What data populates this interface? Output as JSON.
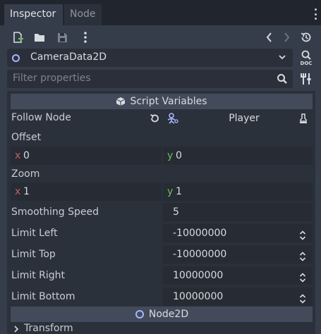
{
  "tabs": [
    {
      "label": "Inspector",
      "active": true
    },
    {
      "label": "Node",
      "active": false
    }
  ],
  "toolbar": {
    "icons": [
      "new-resource-icon",
      "load-resource-icon",
      "save-resource-icon",
      "more-icon",
      "history-back-icon",
      "history-forward-icon",
      "history-icon"
    ]
  },
  "object": {
    "name": "CameraData2D"
  },
  "filter": {
    "placeholder": "Filter properties"
  },
  "sections": {
    "script_variables": "Script Variables",
    "node2d": "Node2D",
    "transform": "Transform"
  },
  "properties": {
    "follow_node": {
      "label": "Follow Node",
      "value": "Player"
    },
    "offset": {
      "label": "Offset",
      "x_axis": "x",
      "x": "0",
      "y_axis": "y",
      "y": "0"
    },
    "zoom": {
      "label": "Zoom",
      "x_axis": "x",
      "x": "1",
      "y_axis": "y",
      "y": "1"
    },
    "smoothing_speed": {
      "label": "Smoothing Speed",
      "value": "5"
    },
    "limit_left": {
      "label": "Limit Left",
      "value": "-10000000"
    },
    "limit_top": {
      "label": "Limit Top",
      "value": "-10000000"
    },
    "limit_right": {
      "label": "Limit Right",
      "value": "10000000"
    },
    "limit_bottom": {
      "label": "Limit Bottom",
      "value": "10000000"
    }
  },
  "colors": {
    "background": "#363d4a",
    "panel": "#2b313b",
    "section_header": "#434b5a",
    "x_axis": "#c06060",
    "y_axis": "#6ebd62",
    "node_accent": "#a6b5ff"
  }
}
